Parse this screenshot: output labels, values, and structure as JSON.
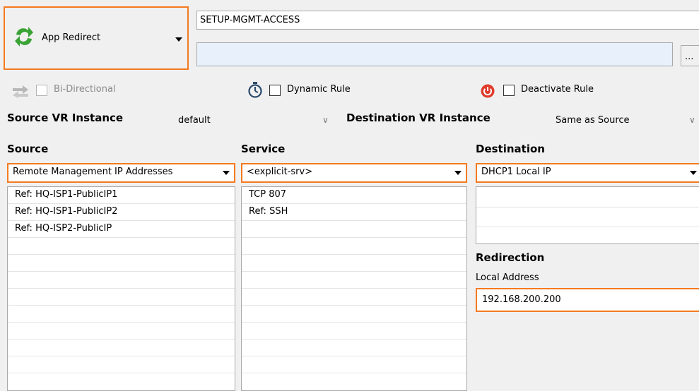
{
  "action": {
    "label": "App Redirect"
  },
  "rule": {
    "name": "SETUP-MGMT-ACCESS",
    "description": "",
    "browse_label": "..."
  },
  "options": {
    "bidirectional": "Bi-Directional",
    "dynamic_rule": "Dynamic Rule",
    "deactivate_rule": "Deactivate Rule"
  },
  "vr": {
    "source_label": "Source VR Instance",
    "source_value": "default",
    "dest_label": "Destination VR Instance",
    "dest_value": "Same as Source"
  },
  "source": {
    "header": "Source",
    "selected": "Remote Management IP Addresses",
    "items": [
      "Ref: HQ-ISP1-PublicIP1",
      "Ref: HQ-ISP1-PublicIP2",
      "Ref: HQ-ISP2-PublicIP"
    ]
  },
  "service": {
    "header": "Service",
    "selected": "<explicit-srv>",
    "items": [
      "TCP  807",
      "Ref: SSH"
    ]
  },
  "destination": {
    "header": "Destination",
    "selected": "DHCP1 Local IP",
    "items": []
  },
  "redirection": {
    "header": "Redirection",
    "local_address_label": "Local Address",
    "local_address_value": "192.168.200.200"
  },
  "colors": {
    "highlight": "#f47a20",
    "field_blue": "#e8f0fb",
    "redirect_green": "#3aa335",
    "power_red": "#e03a2a"
  }
}
